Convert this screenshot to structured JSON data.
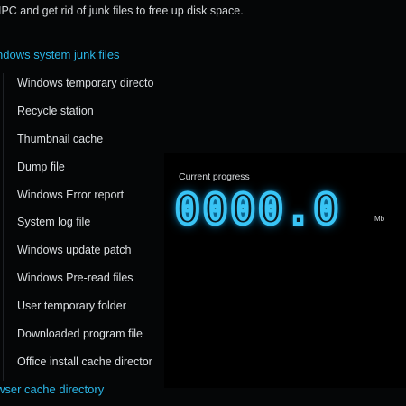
{
  "description": "IPC and get rid of junk files to free up disk space.",
  "groups": [
    {
      "label": "ndows system junk files",
      "items": [
        "Windows temporary directo",
        "Recycle station",
        "Thumbnail cache",
        "Dump file",
        "Windows Error report",
        "System log file",
        "Windows update patch",
        "Windows Pre-read files",
        "User temporary folder",
        "Downloaded program file",
        "Office install cache director"
      ]
    },
    {
      "label": "wser cache directory"
    }
  ],
  "progress": {
    "label": "Current progress",
    "value": "0000.0",
    "unit": "Mb"
  },
  "colors": {
    "background": "#050607",
    "accent": "#2bb7e8",
    "digits_glow": "#39c4f5"
  }
}
